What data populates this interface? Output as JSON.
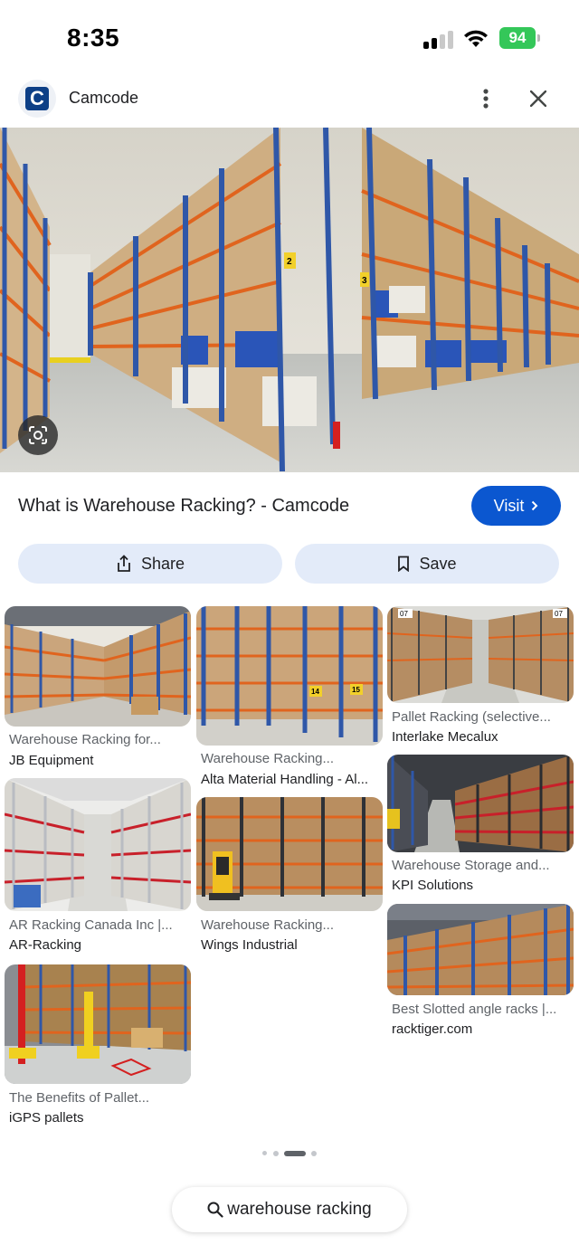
{
  "status_bar": {
    "time": "8:35",
    "battery": "94",
    "icons": [
      "signal-icon",
      "wifi-icon",
      "battery-charging-icon"
    ]
  },
  "source": {
    "name": "Camcode",
    "logo_letter": "C",
    "icons": [
      "more-vert-icon",
      "close-icon"
    ]
  },
  "result": {
    "title": "What is Warehouse Racking? - Camcode",
    "visit_label": "Visit",
    "share_label": "Share",
    "save_label": "Save"
  },
  "related": [
    {
      "title": "Warehouse Racking for...",
      "source": "JB Equipment"
    },
    {
      "title": "Warehouse Racking...",
      "source": "Alta Material Handling - Al..."
    },
    {
      "title": "Pallet Racking (selective...",
      "source": "Interlake Mecalux"
    },
    {
      "title": "AR Racking Canada Inc |...",
      "source": "AR-Racking"
    },
    {
      "title": "Warehouse Racking...",
      "source": "Wings Industrial"
    },
    {
      "title": "Warehouse Storage and...",
      "source": "KPI Solutions"
    },
    {
      "title": "Best Slotted angle racks |...",
      "source": "racktiger.com"
    },
    {
      "title": "The Benefits of Pallet...",
      "source": "iGPS pallets"
    }
  ],
  "thumb_labels": {
    "t2_a": "14",
    "t2_b": "15",
    "t3_a": "07",
    "t3_b": "07",
    "hero_a": "2",
    "hero_b": "3"
  },
  "pager": {
    "count": 4,
    "active": 2
  },
  "search": {
    "query": "warehouse racking"
  },
  "colors": {
    "accent": "#0b57d0",
    "chip": "#e3ebf9",
    "rack_blue": "#2f57a8",
    "beam_orange": "#e0641e",
    "battery": "#34c759"
  }
}
